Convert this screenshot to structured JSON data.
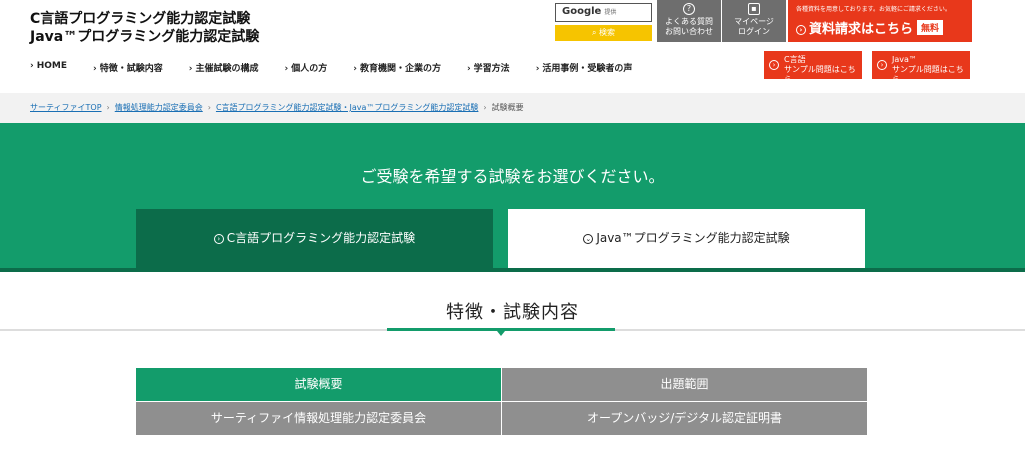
{
  "header": {
    "logo_line1": "C言語プログラミング能力認定試験",
    "logo_line2": "Java™プログラミング能力認定試験",
    "search_brand": "Google",
    "search_sub": "提供",
    "search_button": "検索",
    "faq_line1": "よくある質問",
    "faq_line2": "お問い合わせ",
    "mypage_line1": "マイページ",
    "mypage_line2": "ログイン",
    "doc_note": "各種資料を用意しております。お気軽にご請求ください。",
    "doc_main": "資料請求はこちら",
    "doc_free": "無料"
  },
  "nav": [
    "HOME",
    "特徴・試験内容",
    "主催試験の構成",
    "個人の方",
    "教育機関・企業の方",
    "学習方法",
    "活用事例・受験者の声"
  ],
  "samples": {
    "c_line1": "C言語",
    "c_line2": "サンプル問題はこちら",
    "java_line1": "Java™",
    "java_line2": "サンプル問題はこちら"
  },
  "breadcrumb": {
    "crumb1": "サーティファイTOP",
    "crumb2": "情報処理能力認定委員会",
    "crumb3": "C言語プログラミング能力認定試験・Java™プログラミング能力認定試験",
    "current": "試験概要"
  },
  "hero": {
    "title": "ご受験を希望する試験をお選びください。",
    "tab_c": "C言語プログラミング能力認定試験",
    "tab_java": "Java™プログラミング能力認定試験"
  },
  "section": {
    "title": "特徴・試験内容"
  },
  "grid": [
    "試験概要",
    "出題範囲",
    "サーティファイ情報処理能力認定委員会",
    "オープンバッジ/デジタル認定証明書"
  ],
  "colors": {
    "green": "#139c6b",
    "dark_green": "#0c6c4a",
    "red": "#e8381b",
    "yellow": "#f6c400",
    "gray": "#8f8f8f"
  }
}
